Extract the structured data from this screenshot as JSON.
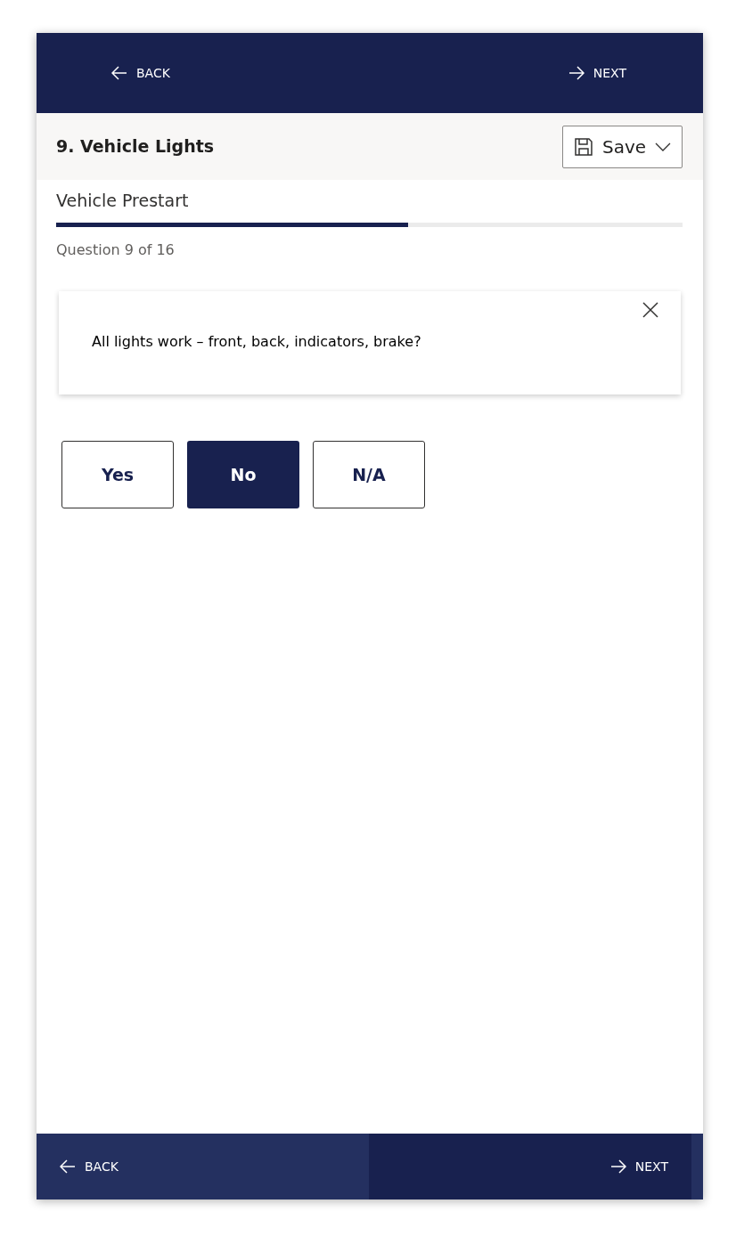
{
  "top_nav": {
    "back": "BACK",
    "next": "NEXT"
  },
  "header": {
    "title": "9. Vehicle Lights",
    "save_button": "Save"
  },
  "section": {
    "title": "Vehicle Prestart",
    "progress": {
      "level": 0.5625
    },
    "counter": "Question 9 of 16"
  },
  "question_card": {
    "text": "All lights work – front, back, indicators, brake?"
  },
  "answers": [
    {
      "label": "Yes",
      "selected": false
    },
    {
      "label": "No",
      "selected": true
    },
    {
      "label": "N/A",
      "selected": false
    }
  ],
  "bottom_nav": {
    "back": {
      "label": "BACK",
      "hovered": true
    },
    "next": {
      "label": "NEXT",
      "hovered": false
    }
  }
}
